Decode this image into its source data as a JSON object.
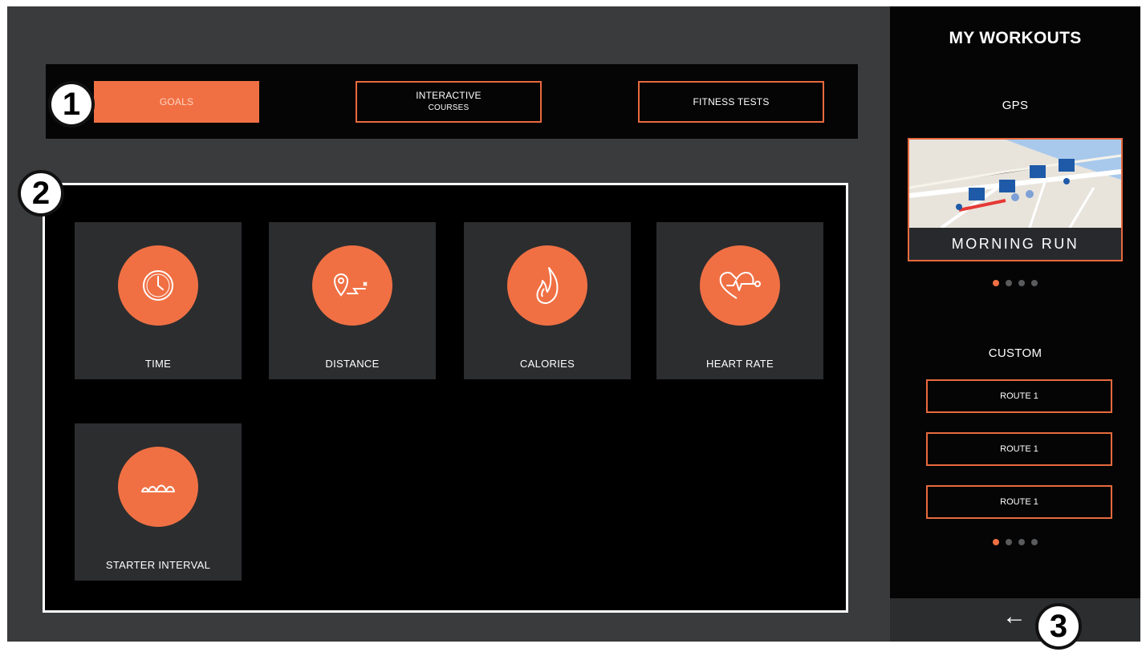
{
  "tabs": [
    {
      "label": "GOALS",
      "sub": "",
      "active": true
    },
    {
      "label": "INTERACTIVE",
      "sub": "COURSES",
      "active": false
    },
    {
      "label": "FITNESS TESTS",
      "sub": "",
      "active": false
    }
  ],
  "callouts": [
    "1",
    "2",
    "3"
  ],
  "goals": [
    {
      "label": "TIME",
      "icon": "clock-icon"
    },
    {
      "label": "DISTANCE",
      "icon": "location-route-icon"
    },
    {
      "label": "CALORIES",
      "icon": "flame-icon"
    },
    {
      "label": "HEART RATE",
      "icon": "heart-pulse-icon"
    },
    {
      "label": "STARTER INTERVAL",
      "icon": "interval-hills-icon"
    }
  ],
  "sidebar": {
    "title": "MY WORKOUTS",
    "gps_label": "GPS",
    "gps_card": {
      "caption": "MORNING RUN"
    },
    "gps_pager": {
      "pages": 4,
      "active": 1
    },
    "custom_label": "CUSTOM",
    "routes": [
      "ROUTE 1",
      "ROUTE 1",
      "ROUTE 1"
    ],
    "custom_pager": {
      "pages": 4,
      "active": 1
    }
  },
  "footer": {
    "back_icon": "left-arrow-icon",
    "back_glyph": "←"
  },
  "colors": {
    "accent": "#f07044",
    "background": "#3a3b3c",
    "panel": "#050505",
    "tile": "#2c2d2f"
  }
}
